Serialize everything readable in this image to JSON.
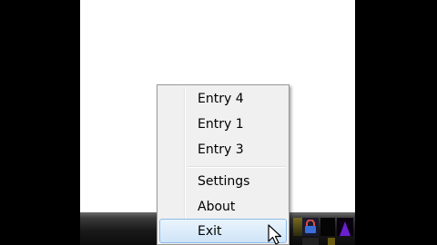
{
  "context_menu": {
    "items": [
      {
        "label": "Entry 4"
      },
      {
        "label": "Entry 1"
      },
      {
        "label": "Entry 3"
      },
      {
        "label": "Settings"
      },
      {
        "label": "About"
      },
      {
        "label": "Exit",
        "state": "highlighted"
      }
    ]
  },
  "colors": {
    "menu_background": "#f0f0f0",
    "menu_border": "#979797",
    "highlight_fill": "#cfe4f7",
    "highlight_border": "#8fb9e6",
    "taskbar": "#1a1a1a"
  },
  "tray": {
    "icons": [
      "app-icon",
      "lock-icon",
      "app-icon",
      "audio-meter-icon"
    ]
  },
  "pointer": {
    "icon": "mouse-pointer-icon"
  }
}
